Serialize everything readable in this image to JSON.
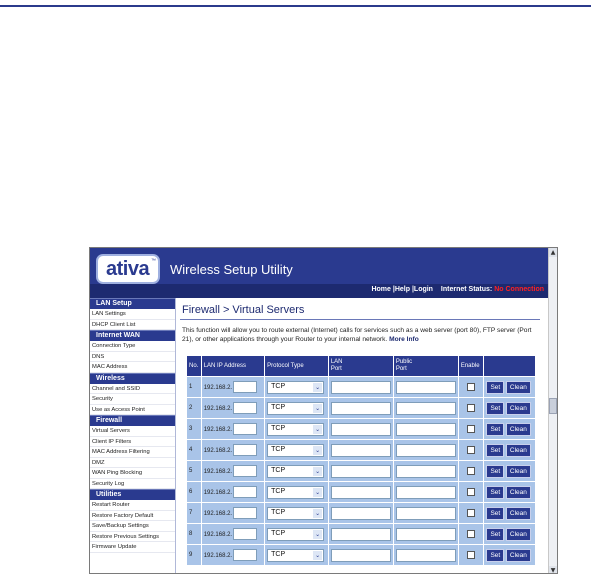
{
  "app": {
    "logo_text": "ativa",
    "logo_tm": "™",
    "title": "Wireless Setup Utility"
  },
  "topnav": {
    "home": "Home",
    "help": "|Help",
    "login": "|Login",
    "status_label": "Internet Status:",
    "status_value": "No Connection"
  },
  "sidebar": {
    "sections": [
      {
        "title": "LAN Setup",
        "items": [
          "LAN Settings",
          "DHCP Client List"
        ]
      },
      {
        "title": "Internet WAN",
        "items": [
          "Connection Type",
          "DNS",
          "MAC Address"
        ]
      },
      {
        "title": "Wireless",
        "items": [
          "Channel and SSID",
          "Security",
          "Use as Access Point"
        ]
      },
      {
        "title": "Firewall",
        "items": [
          "Virtual Servers",
          "Client IP Filters",
          "MAC Address Filtering",
          "DMZ",
          "WAN Ping Blocking",
          "Security Log"
        ]
      },
      {
        "title": "Utilities",
        "items": [
          "Restart Router",
          "Restore Factory Default",
          "Save/Backup Settings",
          "Restore Previous Settings",
          "Firmware Update"
        ]
      }
    ]
  },
  "main": {
    "page_title": "Firewall > Virtual Servers",
    "description": "This function will allow you to route external (Internet) calls for services such as a web server (port 80), FTP server (Port 21), or other applications through your Router to your internal network.",
    "more_info": "More Info"
  },
  "table": {
    "headers": [
      "No.",
      "LAN IP Address",
      "Protocol Type",
      "LAN\nPort",
      "Public\nPort",
      "Enable",
      ""
    ],
    "rows": [
      {
        "no": "1",
        "ip_prefix": "192.168.2.",
        "protocol": "TCP"
      },
      {
        "no": "2",
        "ip_prefix": "192.168.2.",
        "protocol": "TCP"
      },
      {
        "no": "3",
        "ip_prefix": "192.168.2.",
        "protocol": "TCP"
      },
      {
        "no": "4",
        "ip_prefix": "192.168.2.",
        "protocol": "TCP"
      },
      {
        "no": "5",
        "ip_prefix": "192.168.2.",
        "protocol": "TCP"
      },
      {
        "no": "6",
        "ip_prefix": "192.168.2.",
        "protocol": "TCP"
      },
      {
        "no": "7",
        "ip_prefix": "192.168.2.",
        "protocol": "TCP"
      },
      {
        "no": "8",
        "ip_prefix": "192.168.2.",
        "protocol": "TCP"
      },
      {
        "no": "9",
        "ip_prefix": "192.168.2.",
        "protocol": "TCP"
      }
    ],
    "set_label": "Set",
    "clean_label": "Clean"
  },
  "icons": {
    "select_arrow": "chevron-down-icon",
    "scroll_up": "scroll-up-arrow-icon",
    "scroll_down": "scroll-down-arrow-icon"
  },
  "colors": {
    "brand": "#2a3a8f",
    "row_bg": "#a9c4e8",
    "status_alert": "#ff2020"
  }
}
